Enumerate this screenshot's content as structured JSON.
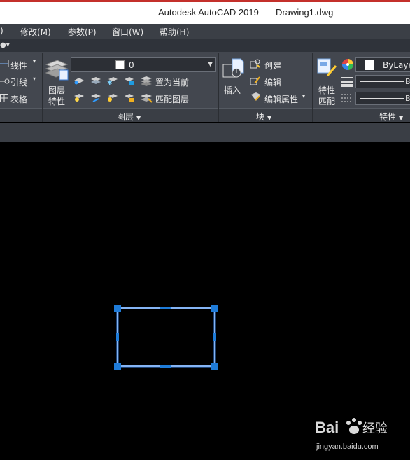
{
  "titlebar": {
    "app": "Autodesk AutoCAD 2019",
    "document": "Drawing1.dwg"
  },
  "menu": {
    "items": [
      {
        "label": ")"
      },
      {
        "label": "修改(M)"
      },
      {
        "label": "参数(P)"
      },
      {
        "label": "窗口(W)"
      },
      {
        "label": "帮助(H)"
      }
    ]
  },
  "ribbon": {
    "draw": {
      "linear": "线性",
      "leader": "引线",
      "table": "表格"
    },
    "layers": {
      "properties": [
        "图层",
        "特性"
      ],
      "current_layer": "0",
      "make_current": "置为当前",
      "match_layer": "匹配图层",
      "panel_title": "图层"
    },
    "block": {
      "insert": "插入",
      "create": "创建",
      "edit": "编辑",
      "edit_attributes": "编辑属性",
      "panel_title": "块"
    },
    "properties": {
      "match": [
        "特性",
        "匹配"
      ],
      "color": "ByLaye",
      "linetype_suffix": "B",
      "lineweight_suffix": "B",
      "panel_title": "特性"
    }
  },
  "colors": {
    "accent": "#1e7bd8",
    "ribbon": "#43474f",
    "selection": "#2a7fe0"
  },
  "watermark": {
    "url": "jingyan.baidu.com"
  }
}
